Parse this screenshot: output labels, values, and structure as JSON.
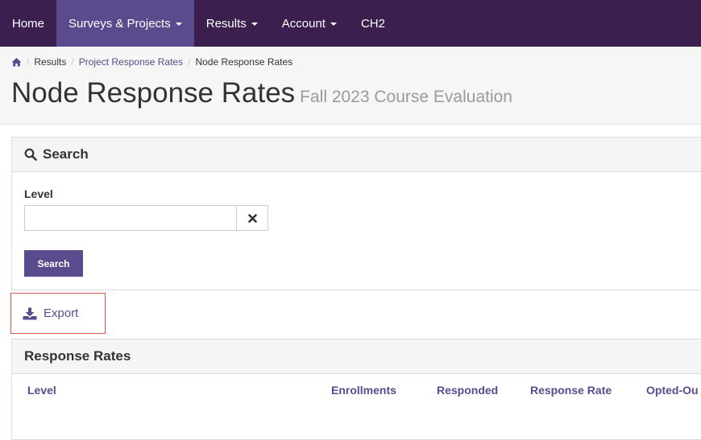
{
  "nav": {
    "items": [
      {
        "label": "Home"
      },
      {
        "label": "Surveys & Projects"
      },
      {
        "label": "Results"
      },
      {
        "label": "Account"
      },
      {
        "label": "CH2"
      }
    ],
    "active_index": 1
  },
  "breadcrumb": {
    "home_icon": "home-icon",
    "results": "Results",
    "project_response_rates": "Project Response Rates",
    "current": "Node Response Rates"
  },
  "page": {
    "title": "Node Response Rates",
    "subtitle": "Fall 2023 Course Evaluation"
  },
  "search": {
    "heading": "Search",
    "heading_icon": "search-icon",
    "level_label": "Level",
    "level_value": "",
    "clear_icon": "clear-icon",
    "button_label": "Search"
  },
  "export": {
    "label": "Export",
    "icon": "download-icon"
  },
  "rates": {
    "heading": "Response Rates",
    "columns": [
      "Level",
      "Enrollments",
      "Responded",
      "Response Rate",
      "Opted-Ou"
    ],
    "rows": []
  },
  "colors": {
    "navbar": "#3b1f4f",
    "accent": "#5a4a8e",
    "highlight_border": "#d9534f"
  }
}
